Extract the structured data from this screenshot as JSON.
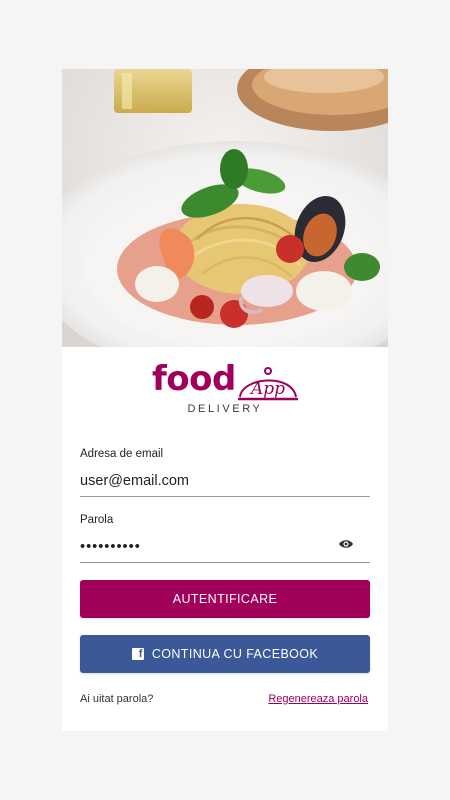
{
  "colors": {
    "brand": "#a0005a",
    "facebook": "#3b5998",
    "page_bg": "#f5f5f5",
    "card_bg": "#ffffff"
  },
  "hero": {
    "image": "pasta-seafood-dish"
  },
  "logo": {
    "word": "food",
    "script": "App",
    "tagline": "DELIVERY"
  },
  "form": {
    "email": {
      "label": "Adresa de email",
      "value": "user@email.com"
    },
    "password": {
      "label": "Parola",
      "value": "••••••••••",
      "toggle_icon": "eye-icon"
    }
  },
  "buttons": {
    "login": "AUTENTIFICARE",
    "facebook": "CONTINUA CU FACEBOOK",
    "facebook_icon": "facebook-icon"
  },
  "footer": {
    "forgot": "Ai uitat parola?",
    "reset_link": "Regenereaza parola"
  }
}
